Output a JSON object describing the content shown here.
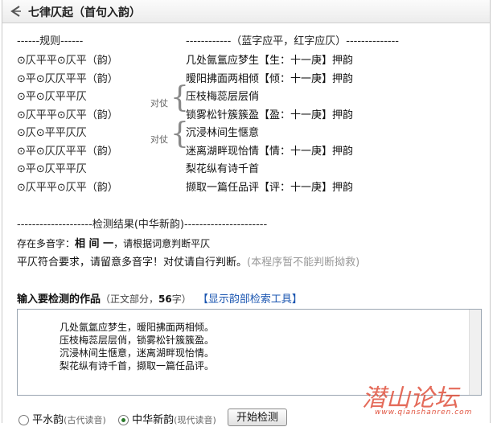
{
  "title": "七律仄起（首句入韵）",
  "rules_header": "------规则------",
  "legend_header": "------------（蓝字应平，红字应仄）--------------",
  "rules": [
    "⊙仄平平⊙仄平（韵）",
    "⊙平⊙仄仄平平（韵）",
    "⊙平⊙仄平平仄",
    "⊙仄平平⊙仄平（韵）",
    "⊙仄⊙平平仄仄",
    "⊙平⊙仄仄平平（韵）",
    "⊙平⊙仄平平仄",
    "⊙仄平平⊙仄平（韵）"
  ],
  "duizhang_label": "对仗",
  "lines": [
    {
      "text": "几处氤氲应梦生",
      "rhyme": "【生：十一庚】押韵"
    },
    {
      "text": "暧阳拂面两相倾",
      "rhyme": "【倾：十一庚】押韵"
    },
    {
      "text": "压枝梅蕊层层俏",
      "rhyme": ""
    },
    {
      "text": "锁雾松针簇簇盈",
      "rhyme": "【盈：十一庚】押韵"
    },
    {
      "text": "沉浸林间生惬意",
      "rhyme": ""
    },
    {
      "text": "迷离湖畔现怡情",
      "rhyme": "【情：十一庚】押韵"
    },
    {
      "text": "梨花纵有诗千首",
      "rhyme": ""
    },
    {
      "text": "撷取一篇任品评",
      "rhyme": "【评：十一庚】押韵"
    }
  ],
  "result_header": "--------------------检测结果(中华新韵)----------------------",
  "polyphone_prefix": "存在多音字：",
  "polyphone_chars": "相 间 一",
  "polyphone_suffix": "，请根据词意判断平仄",
  "verdict_main": "平仄符合要求，请留意多音字！对仗请自行判断。",
  "verdict_note": "(本程序暂不能判断拗救)",
  "input_label": "输入要检测的作品",
  "input_meta_prefix": "（正文部分，",
  "input_meta_count": "56",
  "input_meta_suffix": "字）",
  "tool_link": "【显示韵部检索工具】",
  "poem_text": "几处氤氲应梦生，暧阳拂面两相倾。\n压枝梅蕊层层俏，锁雾松针簇簇盈。\n沉浸林间生惬意，迷离湖畔现怡情。\n梨花纵有诗千首，撷取一篇任品评。",
  "radio_options": [
    {
      "label": "平水韵",
      "note": "(古代读音)",
      "selected": false
    },
    {
      "label": "中华新韵",
      "note": "(现代读音)",
      "selected": true
    }
  ],
  "check_button": "开始检测",
  "watermark_title": "潜山论坛",
  "watermark_url": "www.qianshanren.com",
  "colors": {
    "blue": "#1f3a93",
    "red": "#c0392b",
    "watermark": "#e0523e"
  }
}
